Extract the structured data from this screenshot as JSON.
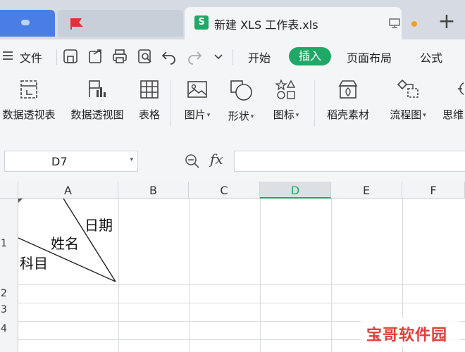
{
  "tabs": {
    "active_title": "新建 XLS 工作表.xls",
    "doc_icon_letter": "S",
    "new_tab_label": "+"
  },
  "menu": {
    "file": "文件",
    "items": [
      "开始",
      "插入",
      "页面布局",
      "公式"
    ],
    "active": "插入"
  },
  "ribbon": {
    "tools": [
      {
        "label": "数据透视表",
        "icon": "pivot-table-icon"
      },
      {
        "label": "数据透视图",
        "icon": "pivot-chart-icon"
      },
      {
        "label": "表格",
        "icon": "table-icon"
      },
      {
        "label": "图片",
        "icon": "picture-icon",
        "dropdown": true
      },
      {
        "label": "形状",
        "icon": "shape-icon",
        "dropdown": true
      },
      {
        "label": "图标",
        "icon": "icons-icon",
        "dropdown": true
      },
      {
        "label": "稻壳素材",
        "icon": "docer-material-icon"
      },
      {
        "label": "流程图",
        "icon": "flowchart-icon",
        "dropdown": true
      },
      {
        "label": "思维",
        "icon": "mindmap-icon"
      }
    ]
  },
  "formula_bar": {
    "name_box": "D7",
    "fx_label": "fx",
    "formula": ""
  },
  "grid": {
    "columns": [
      "A",
      "B",
      "C",
      "D",
      "E",
      "F"
    ],
    "selected_column": "D",
    "rows": [
      "1",
      "2",
      "3",
      "4"
    ],
    "cell_a1": {
      "top_right": "日期",
      "middle": "姓名",
      "bottom_left": "科目"
    }
  },
  "watermark": "宝哥软件园",
  "colors": {
    "accent": "#1fa866",
    "tab_blue": "#4a7ee6",
    "watermark": "#e43d3d"
  }
}
